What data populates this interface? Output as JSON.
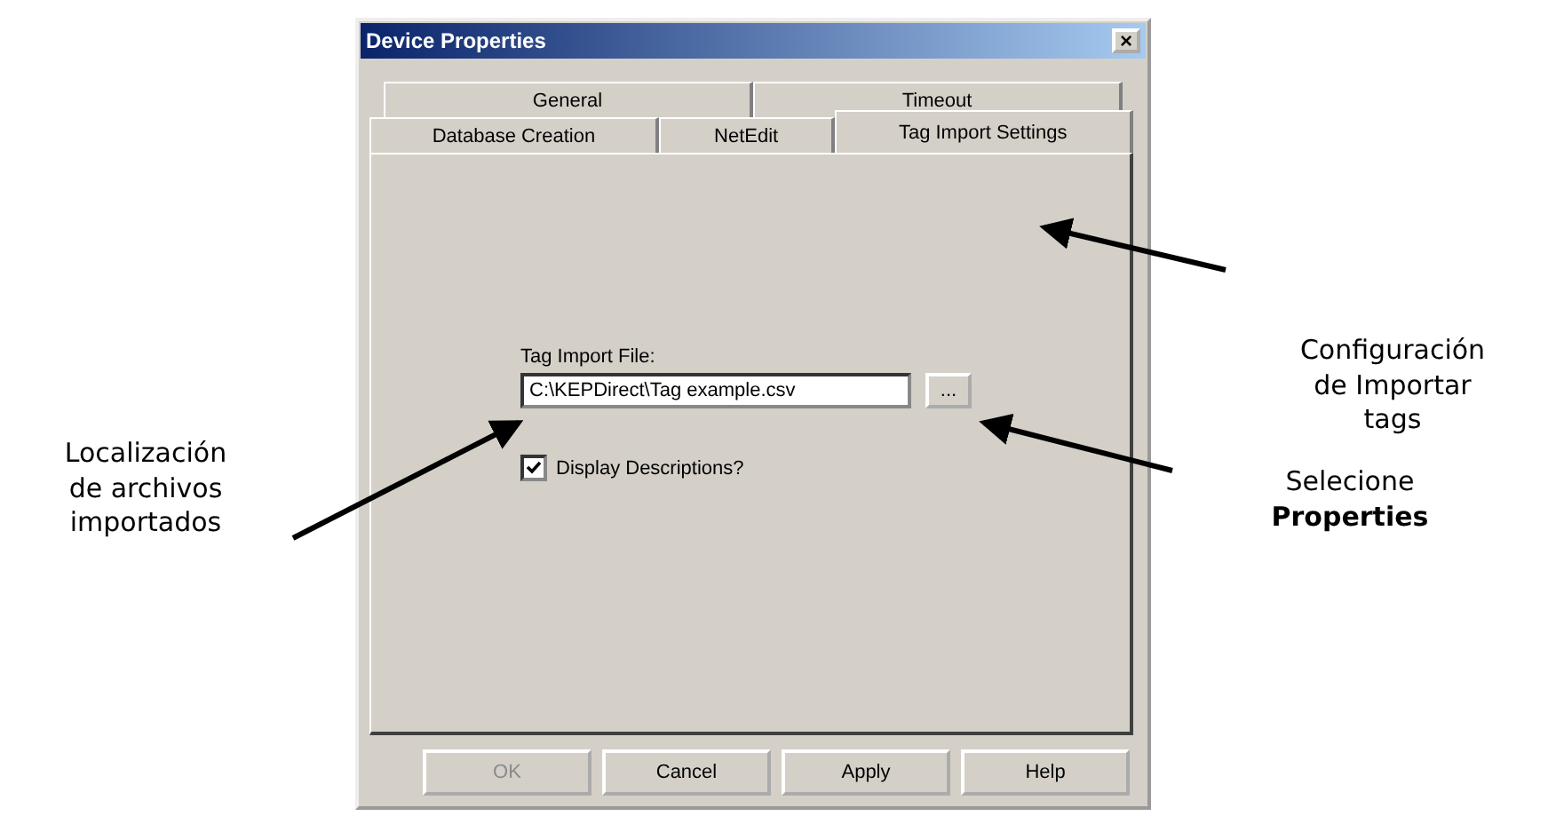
{
  "window": {
    "title": "Device Properties",
    "close": "×"
  },
  "tab_rows": [
    [
      {
        "label": "General",
        "selected": false
      },
      {
        "label": "Timeout",
        "selected": false
      }
    ],
    [
      {
        "label": "Database Creation",
        "selected": false
      },
      {
        "label": "NetEdit",
        "selected": false
      },
      {
        "label": "Tag Import Settings",
        "selected": true
      }
    ]
  ],
  "tag_import_file": {
    "label": "Tag Import File:",
    "value": "C:\\KEPDirect\\Tag example.csv",
    "browse_button": "..."
  },
  "display_descriptions": {
    "label": "Display Descriptions?",
    "checked": true
  },
  "buttons": [
    {
      "label": "OK",
      "disabled": true
    },
    {
      "label": "Cancel",
      "disabled": false
    },
    {
      "label": "Apply",
      "disabled": false
    },
    {
      "label": "Help",
      "disabled": false
    }
  ],
  "annotations": [
    {
      "text": "Configuración de Importar tags"
    },
    {
      "text": "Localización de archivos importados"
    },
    {
      "text": "Selecione **Properties**"
    }
  ]
}
